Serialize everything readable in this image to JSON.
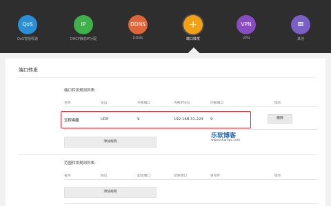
{
  "nav": {
    "items": [
      {
        "icon_text": "QoS",
        "label": "QoS智能限速",
        "color": "#2a8fd6",
        "icon": "qos-icon"
      },
      {
        "icon_text": "IP",
        "label": "DHCP静态IP分配",
        "color": "#3fb14a",
        "icon": "ip-icon"
      },
      {
        "icon_text": "DDNS",
        "label": "DDNS",
        "color": "#e0663a",
        "icon": "ddns-icon"
      },
      {
        "icon_text": "+",
        "label": "端口转发",
        "color": "#f3a019",
        "icon": "port-forward-icon"
      },
      {
        "icon_text": "VPN",
        "label": "VPN",
        "color": "#8a4cc1",
        "icon": "vpn-icon"
      },
      {
        "icon_text": "≡",
        "label": "其他",
        "color": "#7a5fc6",
        "icon": "menu-icon"
      }
    ],
    "active_index": 3
  },
  "panel": {
    "title": "端口转发"
  },
  "forward_list": {
    "title": "端口转发规则列表:",
    "columns": [
      "名称",
      "协议",
      "外部端口",
      "内部IP地址",
      "内部端口",
      "操作"
    ],
    "rows": [
      {
        "name": "远程唤醒",
        "protocol": "UDP",
        "ext_port": "9",
        "ip": "192.168.31.223",
        "int_port": "9",
        "action": "删除"
      }
    ],
    "add_button": "添加规则"
  },
  "range_list": {
    "title": "范围转发规则列表:",
    "columns": [
      "名称",
      "协议",
      "起始端口",
      "结束端口",
      "目标IP",
      "操作"
    ],
    "add_button": "添加规则"
  },
  "watermark": {
    "main": "乐软博客",
    "sub": "www.isharepc.com"
  },
  "colors": {
    "header_bg": "#2e2e2e",
    "highlight": "#e02530"
  }
}
